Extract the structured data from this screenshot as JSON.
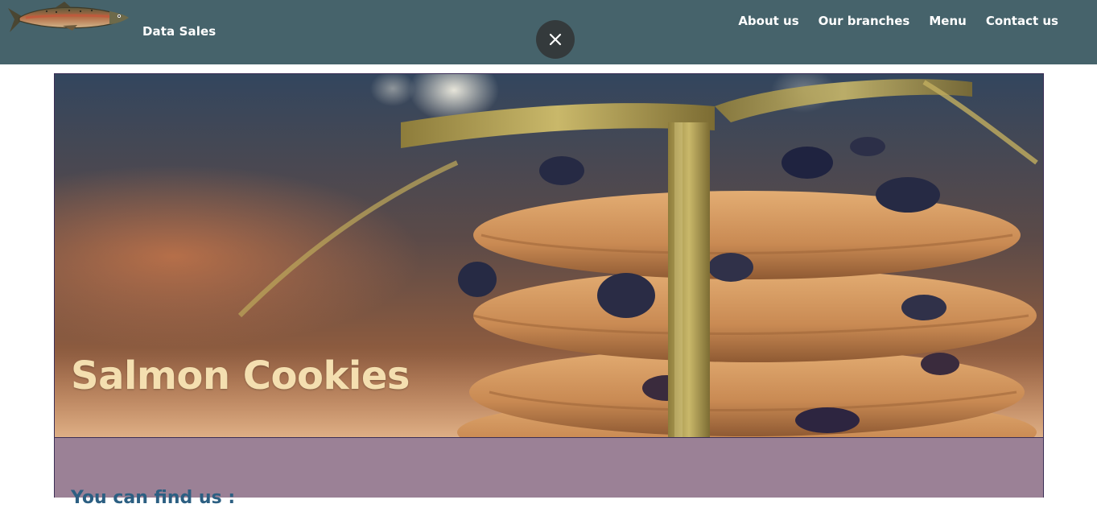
{
  "header": {
    "brand": "Data Sales",
    "logo_icon": "salmon-fish-icon",
    "close_icon": "close-icon",
    "nav": [
      {
        "label": "About us"
      },
      {
        "label": "Our branches"
      },
      {
        "label": "Menu"
      },
      {
        "label": "Contact us"
      }
    ]
  },
  "hero": {
    "title": "Salmon Cookies",
    "image": "stack-of-raisin-cookies-tied-with-gold-ribbon"
  },
  "find_section": {
    "title": "You can find us :"
  },
  "colors": {
    "header_bg": "#46636b",
    "hero_title": "#f4dfb0",
    "section_bg": "#9b8196",
    "section_title": "#2c5f82",
    "close_button_bg": "#343a3c"
  }
}
